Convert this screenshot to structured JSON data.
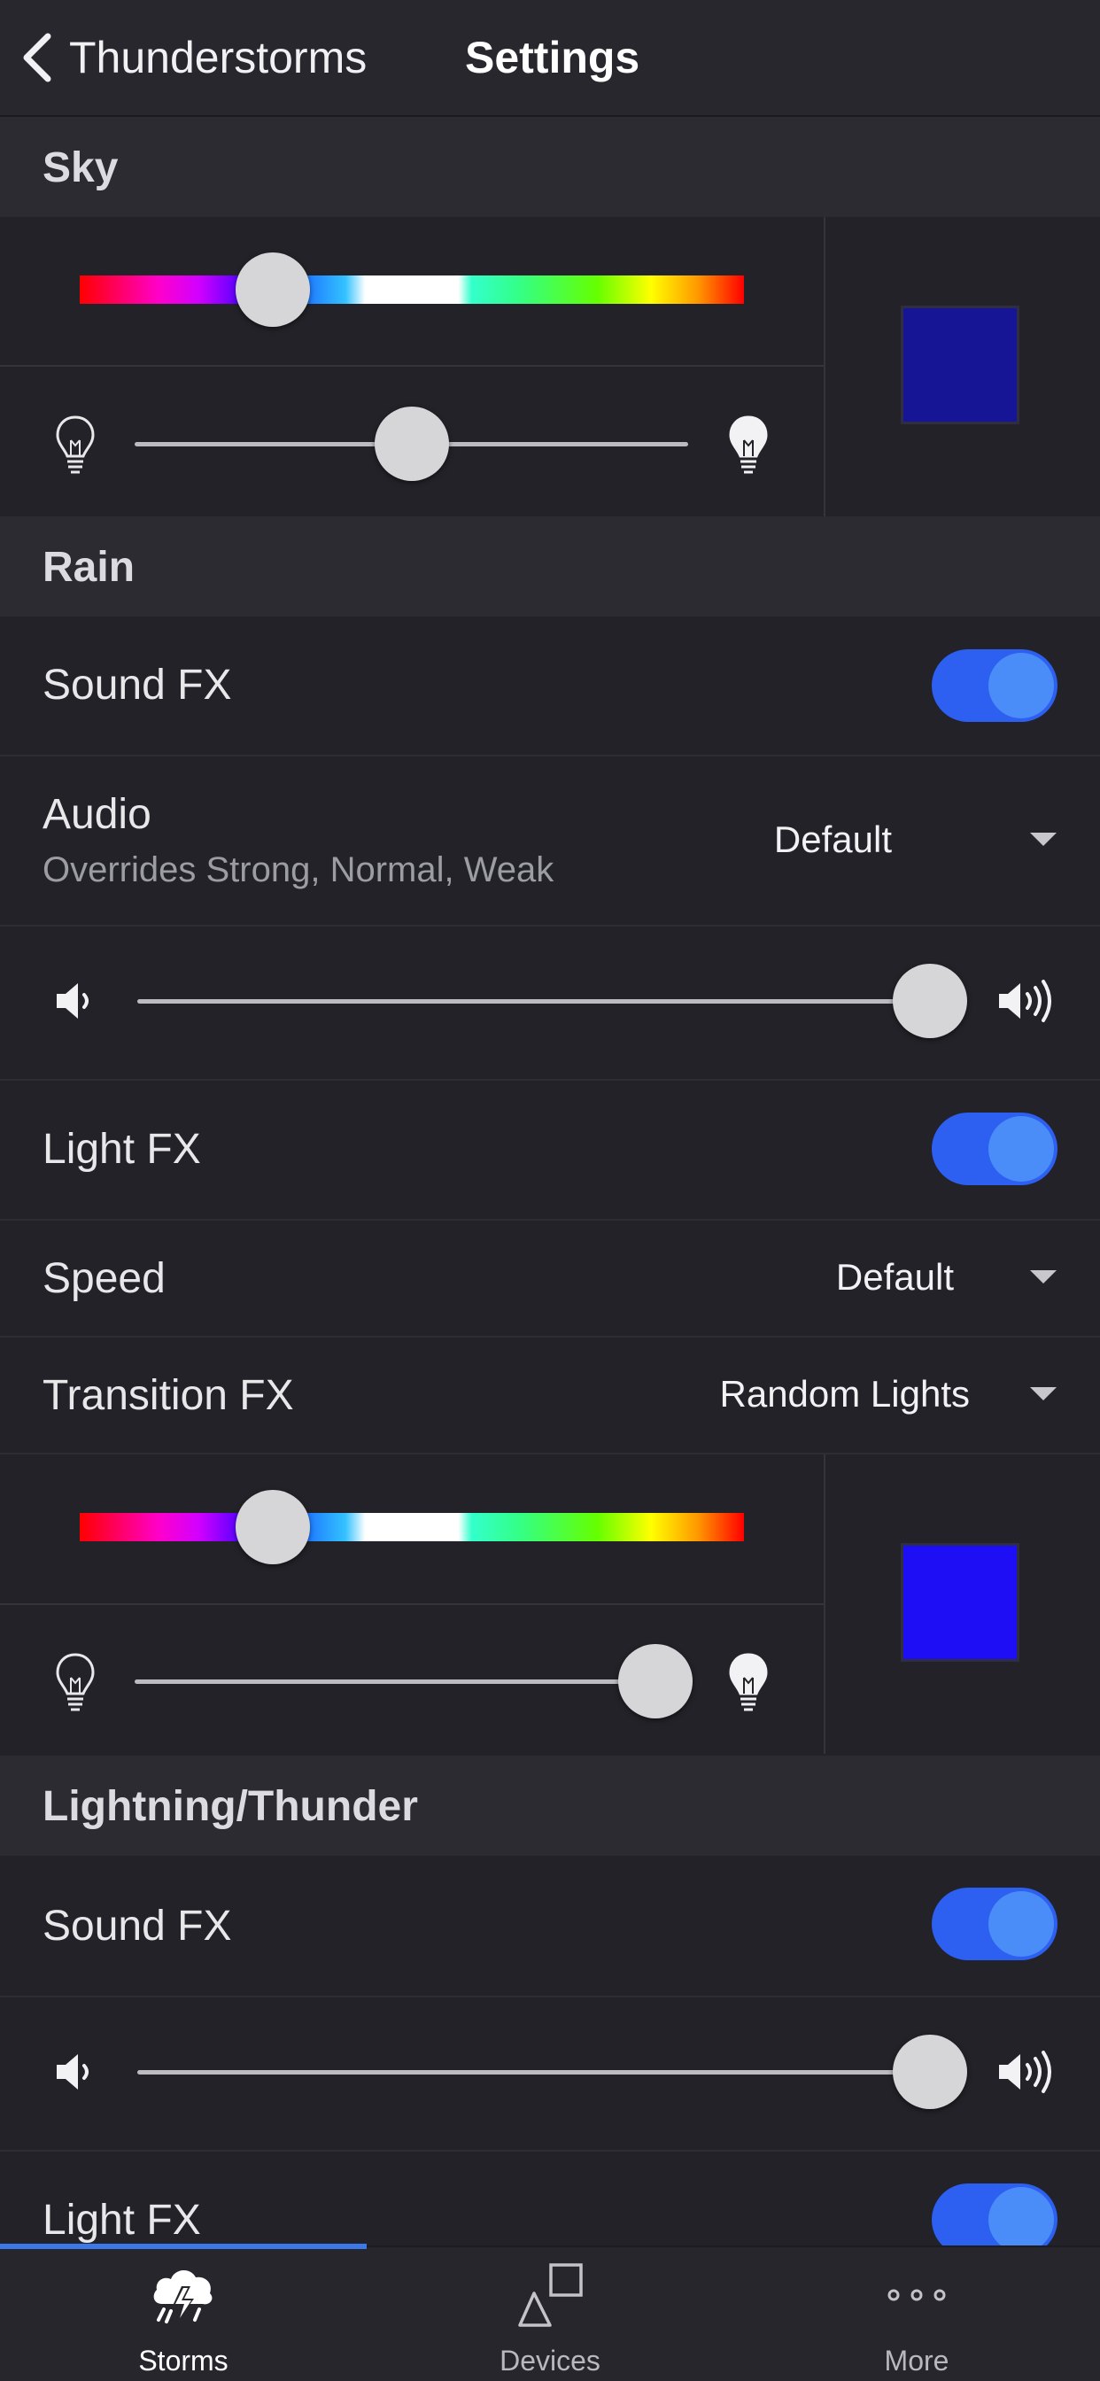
{
  "header": {
    "back_label": "Thunderstorms",
    "title": "Settings"
  },
  "sections": {
    "sky": "Sky",
    "rain": "Rain",
    "lightning": "Lightning/Thunder"
  },
  "sky": {
    "hue_position": 0.29,
    "brightness_position": 0.5,
    "swatch_color": "#161596"
  },
  "rain": {
    "sound_fx": {
      "label": "Sound FX",
      "enabled": true
    },
    "audio": {
      "label": "Audio",
      "sublabel": "Overrides Strong, Normal, Weak",
      "value": "Default"
    },
    "volume_position": 1.0,
    "light_fx": {
      "label": "Light FX",
      "enabled": true
    },
    "speed": {
      "label": "Speed",
      "value": "Default"
    },
    "transition_fx": {
      "label": "Transition FX",
      "value": "Random Lights"
    },
    "hue_position": 0.29,
    "brightness_position": 0.94,
    "swatch_color": "#1d0ef5"
  },
  "lightning": {
    "sound_fx": {
      "label": "Sound FX",
      "enabled": true
    },
    "volume_position": 1.0,
    "light_fx": {
      "label": "Light FX",
      "enabled": true
    }
  },
  "tabs": [
    {
      "label": "Storms",
      "icon": "storm-icon",
      "active": true
    },
    {
      "label": "Devices",
      "icon": "devices-icon",
      "active": false
    },
    {
      "label": "More",
      "icon": "more-icon",
      "active": false
    }
  ],
  "colors": {
    "accent": "#3b78ea",
    "toggle_on": "#2d5ff0"
  }
}
